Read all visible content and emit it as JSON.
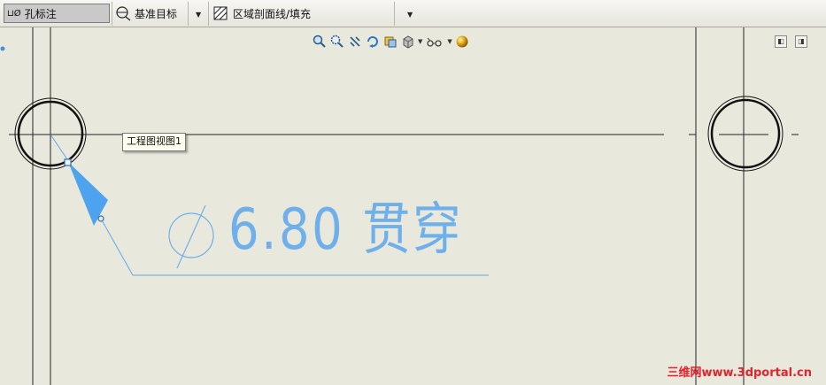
{
  "toolbar": {
    "hole_callout_label": "孔标注",
    "datum_target_label": "基准目标",
    "area_hatch_label": "区域剖面线/填充"
  },
  "tooltip": {
    "text": "工程图视图1"
  },
  "note": {
    "text": "6.80 贯穿"
  },
  "watermark": {
    "text": "三维网www.3dportal.cn"
  },
  "view_tools": [
    "zoom-to-fit-icon",
    "zoom-area-icon",
    "pan-icon",
    "rotate-icon",
    "previous-view-icon",
    "display-style-icon",
    "hide-show-icon",
    "scene-icon"
  ],
  "colors": {
    "annotation": "#6fb0ea",
    "background": "#e9e8dc",
    "watermark": "#e8222a"
  }
}
